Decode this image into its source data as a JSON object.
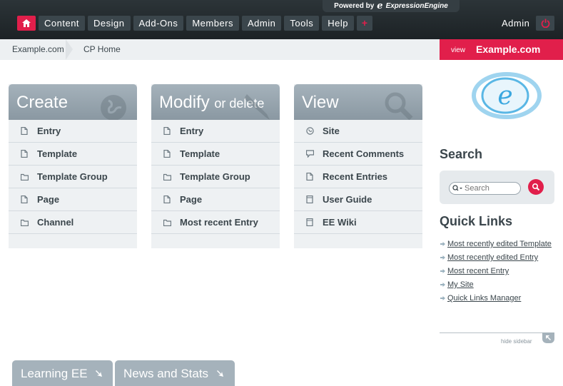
{
  "topbar": {
    "powered_by": "Powered by",
    "brand_mark": "e",
    "brand_name": "ExpressionEngine",
    "nav": [
      "Content",
      "Design",
      "Add-Ons",
      "Members",
      "Admin",
      "Tools",
      "Help"
    ],
    "add_label": "+",
    "user": "Admin"
  },
  "breadcrumb": {
    "site": "Example.com",
    "current": "CP Home"
  },
  "viewsite": {
    "prefix": "view",
    "site": "Example.com"
  },
  "panels": [
    {
      "title": "Create",
      "subtitle": "",
      "items": [
        {
          "label": "Entry",
          "icon": "doc-icon"
        },
        {
          "label": "Template",
          "icon": "doc-icon"
        },
        {
          "label": "Template Group",
          "icon": "folder-icon"
        },
        {
          "label": "Page",
          "icon": "doc-icon"
        },
        {
          "label": "Channel",
          "icon": "folder-icon"
        }
      ]
    },
    {
      "title": "Modify",
      "subtitle": "or delete",
      "items": [
        {
          "label": "Entry",
          "icon": "doc-icon"
        },
        {
          "label": "Template",
          "icon": "doc-icon"
        },
        {
          "label": "Template Group",
          "icon": "folder-icon"
        },
        {
          "label": "Page",
          "icon": "doc-icon"
        },
        {
          "label": "Most recent Entry",
          "icon": "folder-icon"
        }
      ]
    },
    {
      "title": "View",
      "subtitle": "",
      "items": [
        {
          "label": "Site",
          "icon": "globe-icon"
        },
        {
          "label": "Recent Comments",
          "icon": "comment-icon"
        },
        {
          "label": "Recent Entries",
          "icon": "doc-icon"
        },
        {
          "label": "User Guide",
          "icon": "book-icon"
        },
        {
          "label": "EE Wiki",
          "icon": "book-icon"
        }
      ]
    }
  ],
  "sidebar": {
    "search_title": "Search",
    "search_placeholder": "Search",
    "quicklinks_title": "Quick Links",
    "quicklinks": [
      "Most recently edited Template",
      "Most recently edited Entry",
      "Most recent Entry",
      "My Site",
      "Quick Links Manager"
    ],
    "hide_label": "hide sidebar"
  },
  "bottom_tabs": [
    "Learning EE",
    "News and Stats"
  ],
  "colors": {
    "accent": "#e11f4b",
    "panel_header": "#95a3ac",
    "text": "#3b464c"
  }
}
